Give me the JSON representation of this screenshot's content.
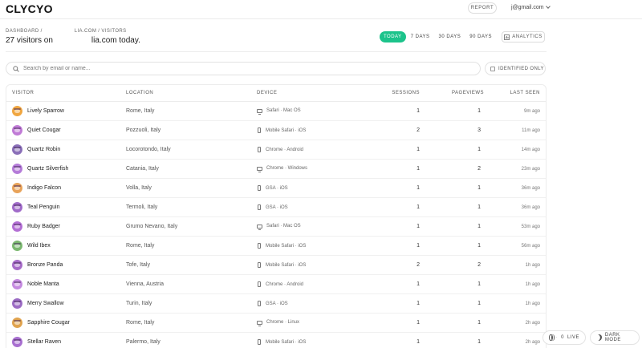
{
  "app": {
    "logo": "CLYCYO"
  },
  "header": {
    "report_label": "REPORT",
    "account_email": "j@gmail.com"
  },
  "breadcrumb": {
    "root": "DASHBOARD /",
    "domain": "LIA.COM / VISITORS"
  },
  "headline": {
    "prefix": "27 visitors on",
    "suffix": "lia.com today."
  },
  "range": {
    "options": [
      "TODAY",
      "7 DAYS",
      "30 DAYS",
      "90 DAYS"
    ],
    "active": "TODAY"
  },
  "analytics": {
    "label": "ANALYTICS"
  },
  "search": {
    "placeholder": "Search by email or name...",
    "value": ""
  },
  "filter": {
    "identified_label": "IDENTIFIED ONLY",
    "checked": false
  },
  "table": {
    "columns": {
      "visitor": "VISITOR",
      "location": "LOCATION",
      "device": "DEVICE",
      "sessions": "SESSIONS",
      "pageviews": "PAGEVIEWS",
      "last_seen": "LAST SEEN"
    },
    "rows": [
      {
        "name": "Lively Sparrow",
        "location": "Rome, Italy",
        "device": "Safari · Mac OS",
        "device_icon": "desktop-icon",
        "sessions": "1",
        "pageviews": "1",
        "last_seen": "9m ago",
        "avatar_color": "#f0a640"
      },
      {
        "name": "Quiet Cougar",
        "location": "Pozzuoli, Italy",
        "device": "Mobile Safari · iOS",
        "device_icon": "mobile-icon",
        "sessions": "2",
        "pageviews": "3",
        "last_seen": "11m ago",
        "avatar_color": "#c07bd6"
      },
      {
        "name": "Quartz Robin",
        "location": "Locorotondo, Italy",
        "device": "Chrome · Android",
        "device_icon": "mobile-icon",
        "sessions": "1",
        "pageviews": "1",
        "last_seen": "14m ago",
        "avatar_color": "#8a6fb8"
      },
      {
        "name": "Quartz Silverfish",
        "location": "Catania, Italy",
        "device": "Chrome · Windows",
        "device_icon": "desktop-icon",
        "sessions": "1",
        "pageviews": "2",
        "last_seen": "23m ago",
        "avatar_color": "#b57cd9"
      },
      {
        "name": "Indigo Falcon",
        "location": "Volla, Italy",
        "device": "GSA · iOS",
        "device_icon": "mobile-icon",
        "sessions": "1",
        "pageviews": "1",
        "last_seen": "36m ago",
        "avatar_color": "#e8a35a"
      },
      {
        "name": "Teal Penguin",
        "location": "Termoli, Italy",
        "device": "GSA · iOS",
        "device_icon": "mobile-icon",
        "sessions": "1",
        "pageviews": "1",
        "last_seen": "36m ago",
        "avatar_color": "#a06bc9"
      },
      {
        "name": "Ruby Badger",
        "location": "Grumo Nevano, Italy",
        "device": "Safari · Mac OS",
        "device_icon": "desktop-icon",
        "sessions": "1",
        "pageviews": "1",
        "last_seen": "53m ago",
        "avatar_color": "#b36fd4"
      },
      {
        "name": "Wild Ibex",
        "location": "Rome, Italy",
        "device": "Mobile Safari · iOS",
        "device_icon": "mobile-icon",
        "sessions": "1",
        "pageviews": "1",
        "last_seen": "56m ago",
        "avatar_color": "#7bb870"
      },
      {
        "name": "Bronze Panda",
        "location": "Tofe, Italy",
        "device": "Mobile Safari · iOS",
        "device_icon": "mobile-icon",
        "sessions": "2",
        "pageviews": "2",
        "last_seen": "1h ago",
        "avatar_color": "#a76cc8"
      },
      {
        "name": "Noble Manta",
        "location": "Vienna, Austria",
        "device": "Chrome · Android",
        "device_icon": "mobile-icon",
        "sessions": "1",
        "pageviews": "1",
        "last_seen": "1h ago",
        "avatar_color": "#c58ae0"
      },
      {
        "name": "Merry Swallow",
        "location": "Turin, Italy",
        "device": "GSA · iOS",
        "device_icon": "mobile-icon",
        "sessions": "1",
        "pageviews": "1",
        "last_seen": "1h ago",
        "avatar_color": "#9c6cc4"
      },
      {
        "name": "Sapphire Cougar",
        "location": "Rome, Italy",
        "device": "Chrome · Linux",
        "device_icon": "desktop-icon",
        "sessions": "1",
        "pageviews": "1",
        "last_seen": "2h ago",
        "avatar_color": "#e0a34e"
      },
      {
        "name": "Stellar Raven",
        "location": "Palermo, Italy",
        "device": "Mobile Safari · iOS",
        "device_icon": "mobile-icon",
        "sessions": "1",
        "pageviews": "1",
        "last_seen": "2h ago",
        "avatar_color": "#a86fd0"
      }
    ]
  },
  "live": {
    "count": "0",
    "label": "LIVE"
  },
  "dark_mode": {
    "label": "DARK MODE"
  },
  "colors": {
    "accent": "#1cc38b",
    "border": "#ececec",
    "text": "#1f1f1f"
  }
}
